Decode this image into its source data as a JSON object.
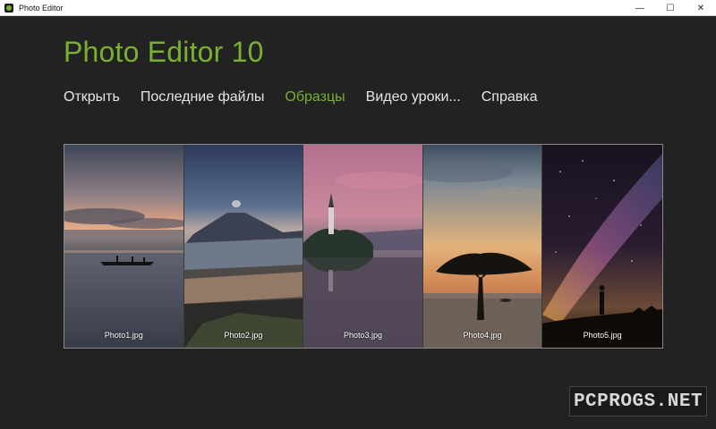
{
  "window": {
    "title": "Photo Editor",
    "controls": {
      "minimize": "—",
      "maximize": "☐",
      "close": "✕"
    }
  },
  "app": {
    "heading": "Photo Editor 10"
  },
  "nav": {
    "items": [
      {
        "label": "Открыть"
      },
      {
        "label": "Последние файлы"
      },
      {
        "label": "Образцы"
      },
      {
        "label": "Видео уроки..."
      },
      {
        "label": "Справка"
      }
    ],
    "active_index": 2
  },
  "gallery": {
    "photos": [
      {
        "caption": "Photo1.jpg"
      },
      {
        "caption": "Photo2.jpg"
      },
      {
        "caption": "Photo3.jpg"
      },
      {
        "caption": "Photo4.jpg"
      },
      {
        "caption": "Photo5.jpg"
      }
    ]
  },
  "watermark": {
    "text": "PCPROGS.NET"
  },
  "colors": {
    "accent": "#7ab032",
    "background": "#222222",
    "text": "#e6e6e6"
  }
}
